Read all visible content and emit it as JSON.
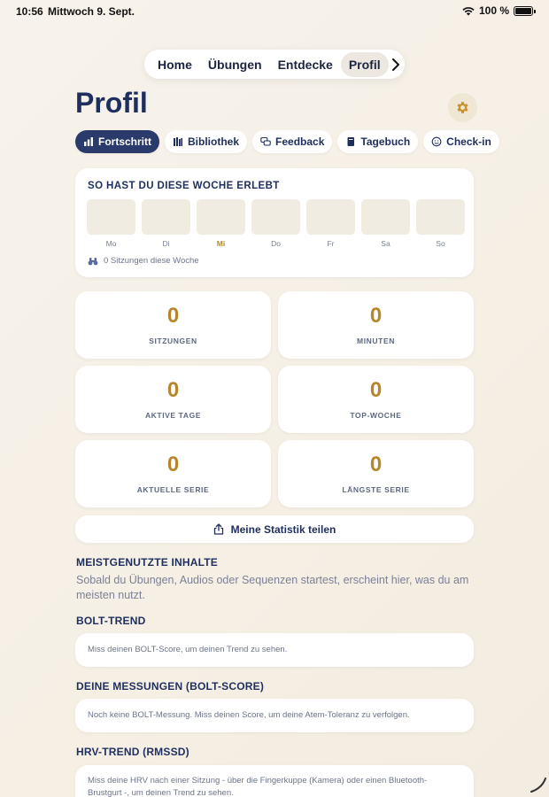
{
  "statusbar": {
    "time": "10:56",
    "date": "Mittwoch 9. Sept.",
    "battery": "100 %"
  },
  "nav": {
    "tabs": [
      "Home",
      "Übungen",
      "Entdecke",
      "Profil"
    ],
    "active": "Profil"
  },
  "header": {
    "title": "Profil"
  },
  "pills": [
    "Fortschritt",
    "Bibliothek",
    "Feedback",
    "Tagebuch",
    "Check-in"
  ],
  "week": {
    "heading": "SO HAST DU DIESE WOCHE ERLEBT",
    "days": [
      "Mo",
      "Di",
      "Mi",
      "Do",
      "Fr",
      "Sa",
      "So"
    ],
    "today": "Mi",
    "sessions_text": "0 Sitzungen diese Woche"
  },
  "stats": [
    {
      "value": "0",
      "label": "SITZUNGEN"
    },
    {
      "value": "0",
      "label": "MINUTEN"
    },
    {
      "value": "0",
      "label": "AKTIVE TAGE"
    },
    {
      "value": "0",
      "label": "TOP-WOCHE"
    },
    {
      "value": "0",
      "label": "AKTUELLE SERIE"
    },
    {
      "value": "0",
      "label": "LÄNGSTE SERIE"
    }
  ],
  "share_label": "Meine Statistik teilen",
  "most_used": {
    "heading": "MEISTGENUTZTE INHALTE",
    "text": "Sobald du Übungen, Audios oder Sequenzen startest, erscheint hier, was du am meisten nutzt."
  },
  "bolt_trend": {
    "heading": "BOLT-TREND",
    "text": "Miss deinen BOLT-Score, um deinen Trend zu sehen."
  },
  "measurements": {
    "heading": "DEINE MESSUNGEN (BOLT-SCORE)",
    "text": "Noch keine BOLT-Messung. Miss deinen Score, um deine Atem-Toleranz zu verfolgen."
  },
  "hrv_trend": {
    "heading": "HRV-TREND (RMSSD)",
    "text": "Miss deine HRV nach einer Sitzung - über die Fingerkuppe (Kamera) oder einen Bluetooth-Brustgurt -, um deinen Trend zu sehen."
  },
  "colors": {
    "accent": "#b8862a",
    "primary": "#2a3a6b",
    "background": "#f6f1e8"
  }
}
